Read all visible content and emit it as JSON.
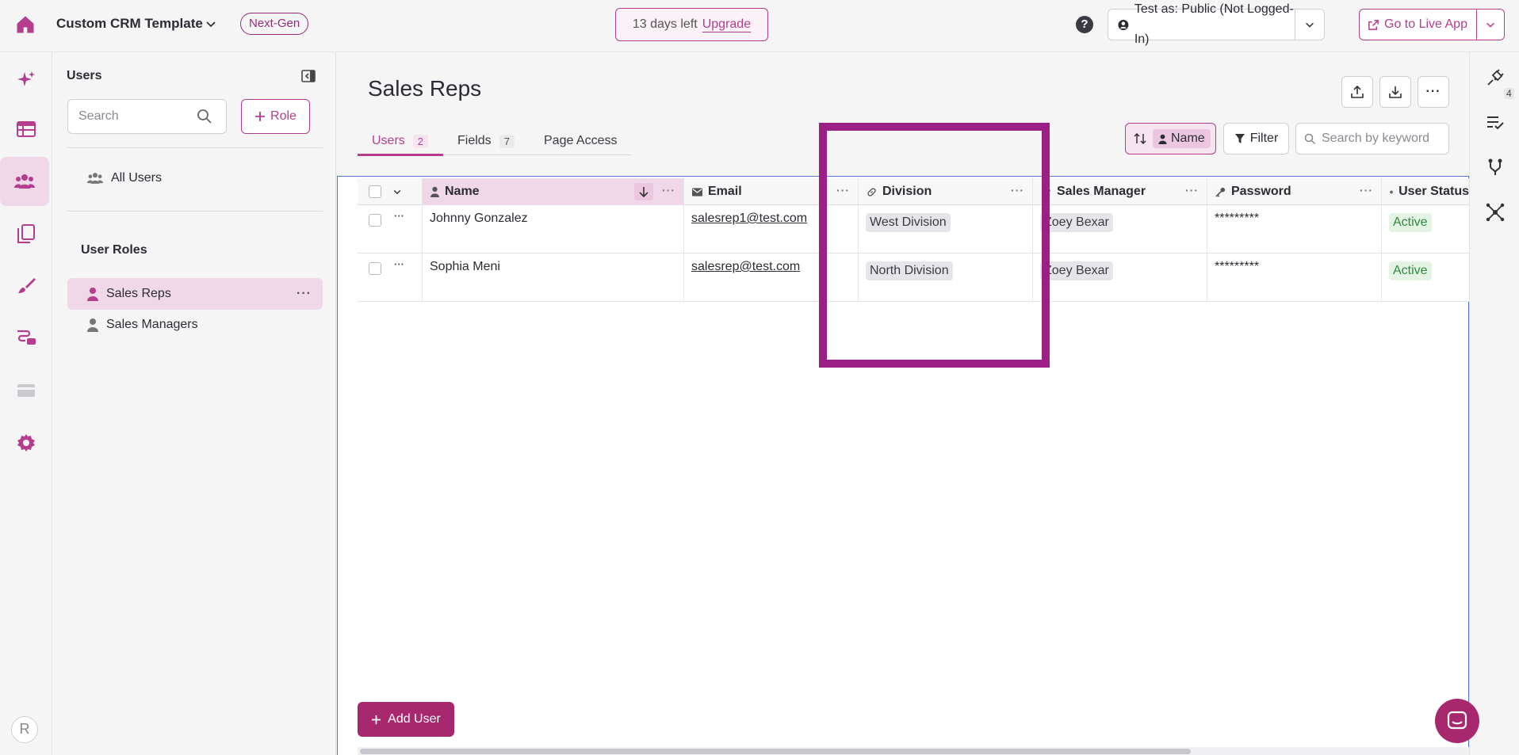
{
  "topbar": {
    "app_title": "Custom CRM Template",
    "badge": "Next-Gen",
    "trial_text": "13 days left",
    "upgrade_label": "Upgrade",
    "help_label": "?",
    "test_as": "Test as: Public (Not Logged-In)",
    "go_live": "Go to Live App"
  },
  "rail": {
    "items": [
      "home-icon",
      "sparkles-icon",
      "table-icon",
      "users-icon",
      "pages-icon",
      "brush-icon",
      "flows-icon",
      "payments-icon",
      "settings-icon"
    ],
    "active": "users-icon",
    "avatar": "R"
  },
  "panel": {
    "title": "Users",
    "search_placeholder": "Search",
    "role_button": "Role",
    "all_users": "All Users",
    "roles_heading": "User Roles",
    "roles": [
      "Sales Reps",
      "Sales Managers"
    ],
    "active_role": "Sales Reps",
    "role_more": "···"
  },
  "main": {
    "title": "Sales Reps",
    "tabs": [
      {
        "label": "Users",
        "count": "2"
      },
      {
        "label": "Fields",
        "count": "7"
      },
      {
        "label": "Page Access",
        "count": ""
      }
    ],
    "more_label": "···",
    "sort_label": "Name",
    "filter_label": "Filter",
    "keyword_placeholder": "Search by keyword",
    "add_user": "Add User"
  },
  "table": {
    "columns": [
      "Name",
      "Email",
      "Division",
      "Sales Manager",
      "Password",
      "User Status"
    ],
    "col_more": "···",
    "rows": [
      {
        "name": "Johnny Gonzalez",
        "email": "salesrep1@test.com",
        "division": "West Division",
        "manager": "Zoey Bexar",
        "password": "*********",
        "status": "Active",
        "more": "···"
      },
      {
        "name": "Sophia Meni",
        "email": "salesrep@test.com",
        "division": "North Division",
        "manager": "Zoey Bexar",
        "password": "*********",
        "status": "Active",
        "more": "···"
      }
    ]
  },
  "right_rail": {
    "items": [
      "plug-icon",
      "checklist-icon",
      "branch-icon",
      "network-icon"
    ],
    "plug_count": "4"
  },
  "colors": {
    "accent": "#b53d8d",
    "highlight": "#9b1f84",
    "active_bg": "#f0d8e9",
    "status_green": "#2e8b3e"
  }
}
